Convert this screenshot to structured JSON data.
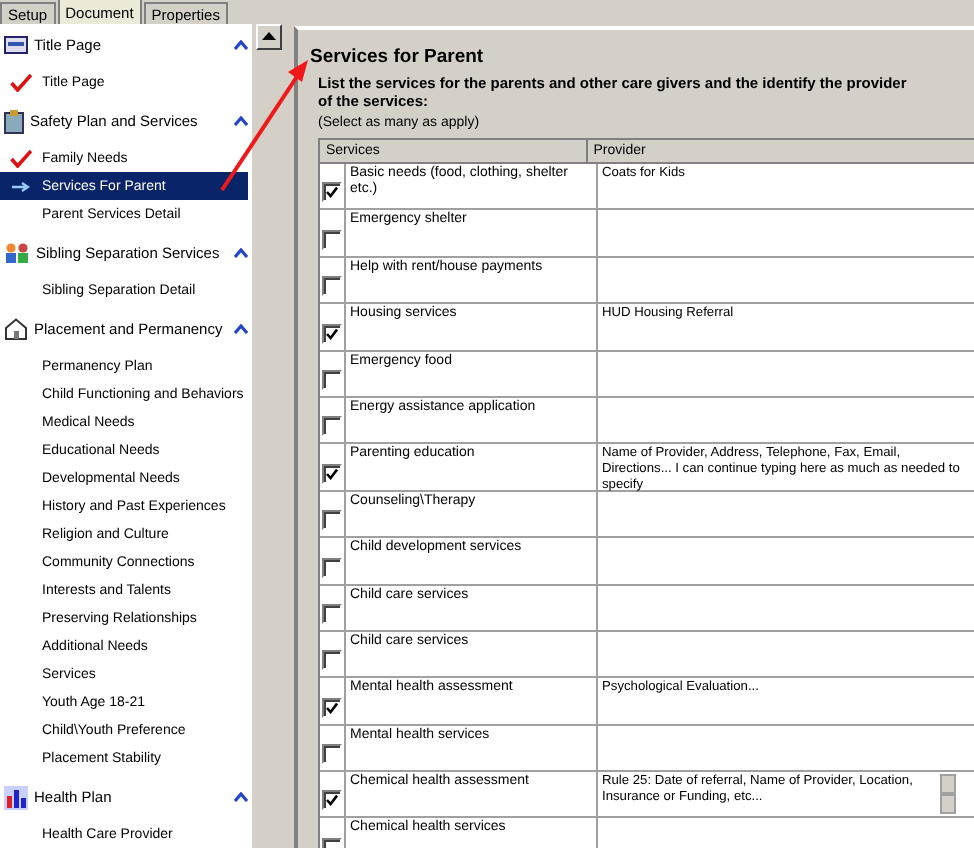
{
  "tabs": [
    {
      "label": "Setup",
      "selected": false
    },
    {
      "label": "Document",
      "selected": true
    },
    {
      "label": "Properties",
      "selected": false
    }
  ],
  "sidebar": {
    "sections": [
      {
        "title": "Title Page",
        "expanded": true,
        "children": [
          {
            "label": "Title Page",
            "checked": true,
            "selected": false
          }
        ]
      },
      {
        "title": "Safety Plan and Services",
        "expanded": true,
        "children": [
          {
            "label": "Family Needs",
            "checked": true,
            "selected": false
          },
          {
            "label": "Services For Parent",
            "checked": false,
            "selected": true
          },
          {
            "label": "Parent Services Detail",
            "checked": false,
            "selected": false
          }
        ]
      },
      {
        "title": "Sibling Separation Services",
        "expanded": true,
        "children": [
          {
            "label": "Sibling Separation Detail",
            "checked": false,
            "selected": false
          }
        ]
      },
      {
        "title": "Placement and Permanency",
        "expanded": true,
        "children": [
          {
            "label": "Permanency Plan",
            "checked": false,
            "selected": false
          },
          {
            "label": "Child Functioning and Behaviors",
            "checked": false,
            "selected": false
          },
          {
            "label": "Medical Needs",
            "checked": false,
            "selected": false
          },
          {
            "label": "Educational Needs",
            "checked": false,
            "selected": false
          },
          {
            "label": "Developmental Needs",
            "checked": false,
            "selected": false
          },
          {
            "label": "History and Past Experiences",
            "checked": false,
            "selected": false
          },
          {
            "label": "Religion and Culture",
            "checked": false,
            "selected": false
          },
          {
            "label": "Community Connections",
            "checked": false,
            "selected": false
          },
          {
            "label": "Interests and Talents",
            "checked": false,
            "selected": false
          },
          {
            "label": "Preserving Relationships",
            "checked": false,
            "selected": false
          },
          {
            "label": "Additional Needs",
            "checked": false,
            "selected": false
          },
          {
            "label": "Services",
            "checked": false,
            "selected": false
          },
          {
            "label": "Youth Age 18-21",
            "checked": false,
            "selected": false
          },
          {
            "label": "Child\\Youth Preference",
            "checked": false,
            "selected": false
          },
          {
            "label": "Placement Stability",
            "checked": false,
            "selected": false
          }
        ]
      },
      {
        "title": "Health Plan",
        "expanded": true,
        "children": [
          {
            "label": "Health Care Provider",
            "checked": false,
            "selected": false
          }
        ]
      }
    ]
  },
  "form": {
    "title": "Services for Parent",
    "instruction": "List the services for the parents and other care givers and the identify the provider of the services:",
    "hint": "(Select as many as apply)",
    "table": {
      "columns": [
        "Services",
        "Provider"
      ],
      "rows": [
        {
          "checked": true,
          "service": "Basic needs (food, clothing, shelter etc.)",
          "provider": "Coats for Kids",
          "scrollable": false
        },
        {
          "checked": false,
          "service": "Emergency shelter",
          "provider": "",
          "scrollable": false
        },
        {
          "checked": false,
          "service": "Help with rent/house payments",
          "provider": "",
          "scrollable": false
        },
        {
          "checked": true,
          "service": "Housing services",
          "provider": "HUD Housing Referral",
          "scrollable": false
        },
        {
          "checked": false,
          "service": "Emergency food",
          "provider": "",
          "scrollable": false
        },
        {
          "checked": false,
          "service": "Energy assistance application",
          "provider": "",
          "scrollable": false
        },
        {
          "checked": true,
          "service": "Parenting education",
          "provider": "Name of Provider, Address, Telephone, Fax, Email, Directions... I can continue typing here as much as needed to specify",
          "scrollable": false
        },
        {
          "checked": false,
          "service": "Counseling\\Therapy",
          "provider": "",
          "scrollable": false
        },
        {
          "checked": false,
          "service": "Child development services",
          "provider": "",
          "scrollable": false
        },
        {
          "checked": false,
          "service": "Child care services",
          "provider": "",
          "scrollable": false
        },
        {
          "checked": false,
          "service": "Child care services",
          "provider": "",
          "scrollable": false
        },
        {
          "checked": true,
          "service": "Mental health assessment",
          "provider": "Psychological Evaluation...",
          "scrollable": false
        },
        {
          "checked": false,
          "service": "Mental health services",
          "provider": "",
          "scrollable": false
        },
        {
          "checked": true,
          "service": "Chemical health assessment",
          "provider": "Rule 25: Date of referral, Name of Provider, Location, Insurance or Funding, etc...",
          "scrollable": true
        },
        {
          "checked": false,
          "service": "Chemical health services",
          "provider": "",
          "scrollable": false
        }
      ]
    }
  }
}
